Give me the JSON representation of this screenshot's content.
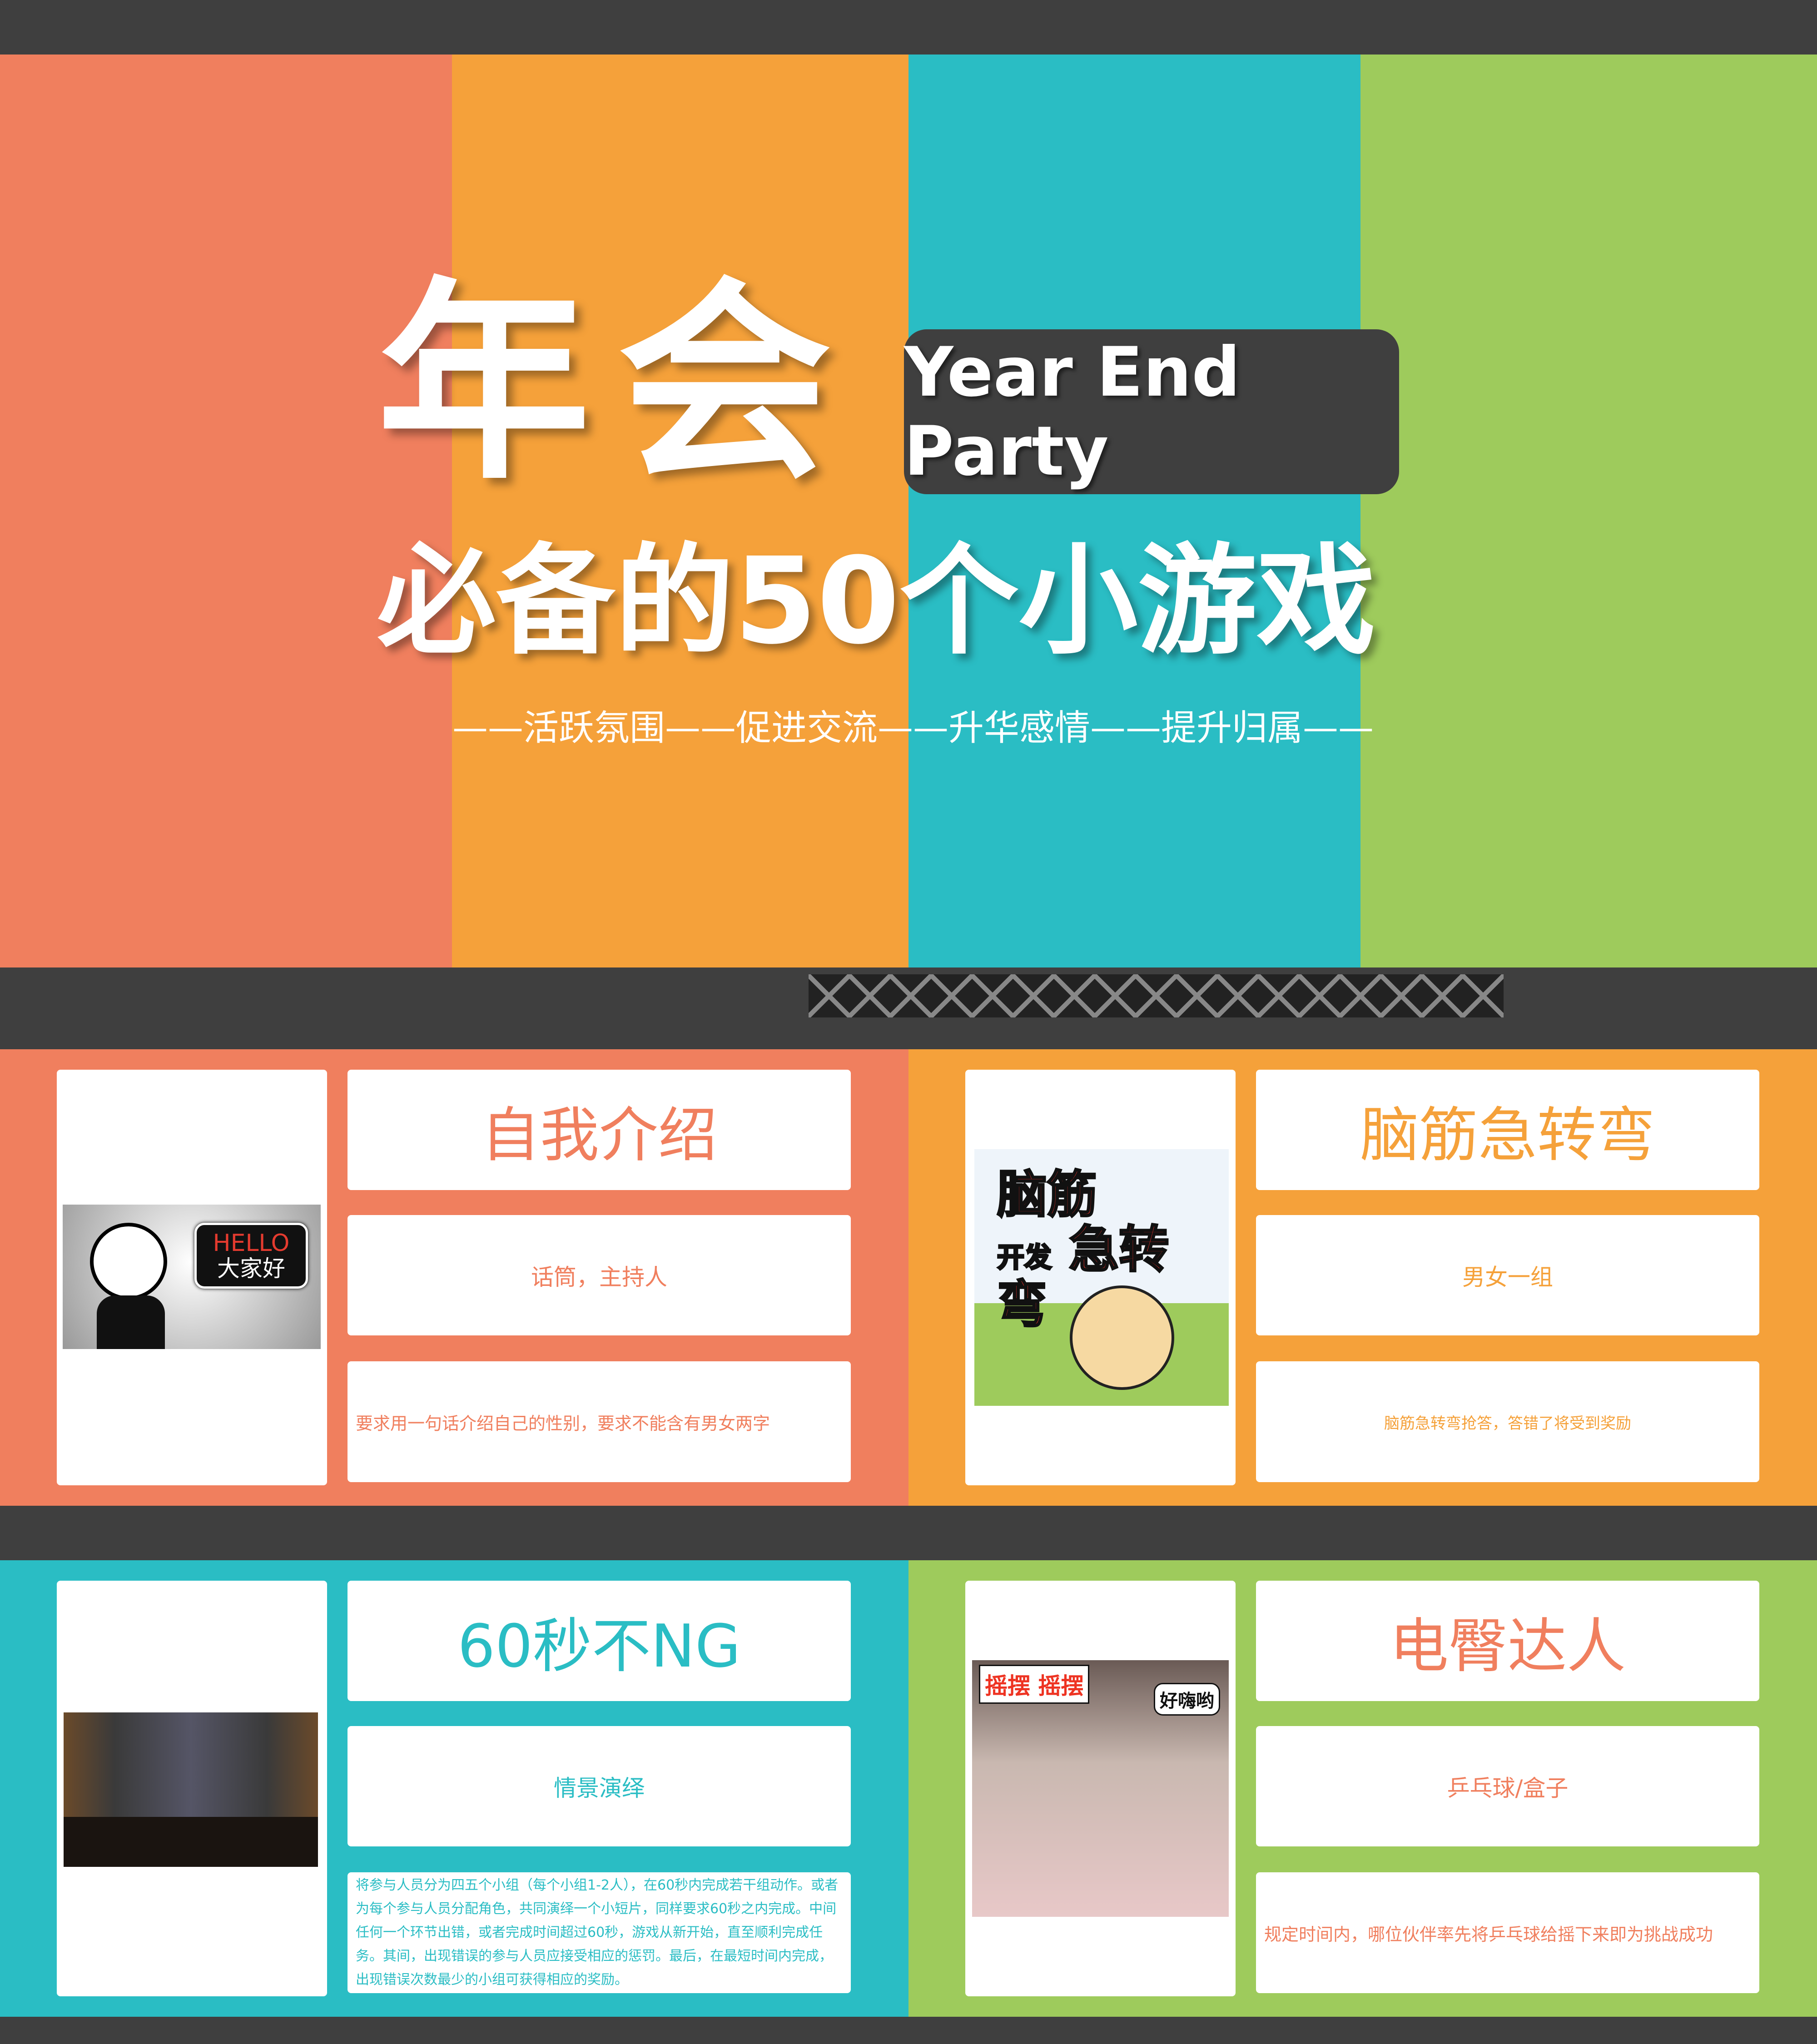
{
  "colors": {
    "coral": "#F07F5E",
    "orange": "#F5A13A",
    "teal": "#2ABDC4",
    "green": "#9ECB5C",
    "dark": "#3F3F3F"
  },
  "hero": {
    "title": "年会",
    "english": "Year End Party",
    "subtitle": "必备的50个小游戏",
    "tagline": "——活跃氛围——促进交流——升华感情——提升归属——"
  },
  "games": [
    {
      "title": "自我介绍",
      "props": "话筒，主持人",
      "description": "要求用一句话介绍自己的性别，要求不能含有男女两字",
      "image": {
        "bubble_line1": "HELLO",
        "bubble_line2": "大家好"
      }
    },
    {
      "title": "脑筋急转弯",
      "props": "男女一组",
      "description": "脑筋急转弯抢答，答错了将受到奖励",
      "image": {
        "logo": "脑筋急转弯 开发"
      }
    },
    {
      "title": "60秒不NG",
      "props": "情景演绎",
      "description": "将参与人员分为四五个小组（每个小组1-2人），在60秒内完成若干组动作。或者为每个参与人员分配角色，共同演绎一个小短片，同样要求60秒之内完成。中间任何一个环节出错，或者完成时间超过60秒，游戏从新开始，直至顺利完成任务。其间，出现错误的参与人员应接受相应的惩罚。最后，在最短时间内完成，出现错误次数最少的小组可获得相应的奖励。"
    },
    {
      "title": "电臀达人",
      "props": "乒乓球/盒子",
      "description": "规定时间内，哪位伙伴率先将乒乓球给摇下来即为挑战成功",
      "image": {
        "caption1": "摇摆 摇摆",
        "caption2": "好嗨哟"
      }
    }
  ]
}
